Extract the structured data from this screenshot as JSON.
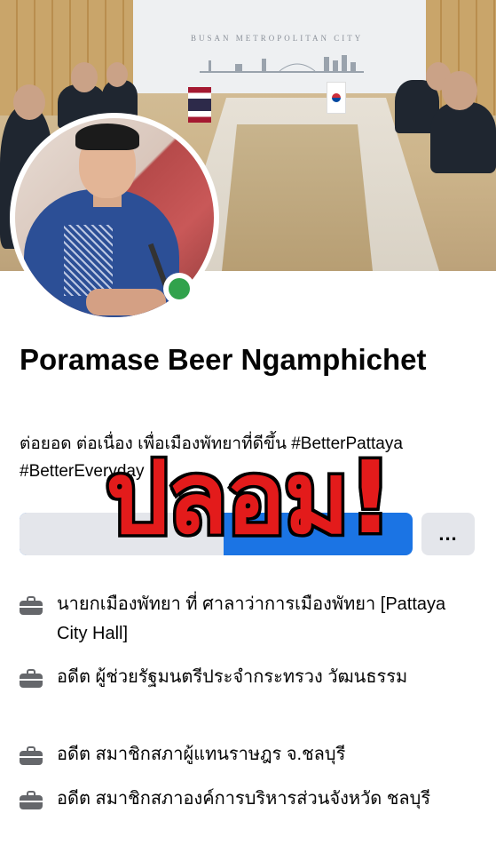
{
  "cover": {
    "wall_caption": "BUSAN METROPOLITAN CITY"
  },
  "profile": {
    "name": "Poramase Beer Ngamphichet",
    "bio": "ต่อยอด ต่อเนื่อง เพื่อเมืองพัทยาที่ดีขึ้น #BetterPattaya #BetterEveryday",
    "online": true
  },
  "buttons": {
    "more_label": "..."
  },
  "overlay": {
    "stamp_text": "ปลอม!",
    "stamp_color": "#e31b1b"
  },
  "work": [
    {
      "icon": "briefcase-icon",
      "text": "นายกเมืองพัทยา ที่ ศาลาว่าการเมืองพัทยา [Pattaya City Hall]"
    },
    {
      "icon": "briefcase-icon",
      "text": "อดีต ผู้ช่วยรัฐมนตรีประจำกระทรวง วัฒนธรรม"
    },
    {
      "icon": "briefcase-icon",
      "text": "อดีต สมาชิกสภาผู้แทนราษฎร จ.ชลบุรี"
    },
    {
      "icon": "briefcase-icon",
      "text": "อดีต สมาชิกสภาองค์การบริหารส่วนจังหวัด ชลบุรี"
    }
  ],
  "colors": {
    "primary_button": "#1b74e4",
    "online": "#31a24c",
    "icon_gray": "#65676b"
  }
}
